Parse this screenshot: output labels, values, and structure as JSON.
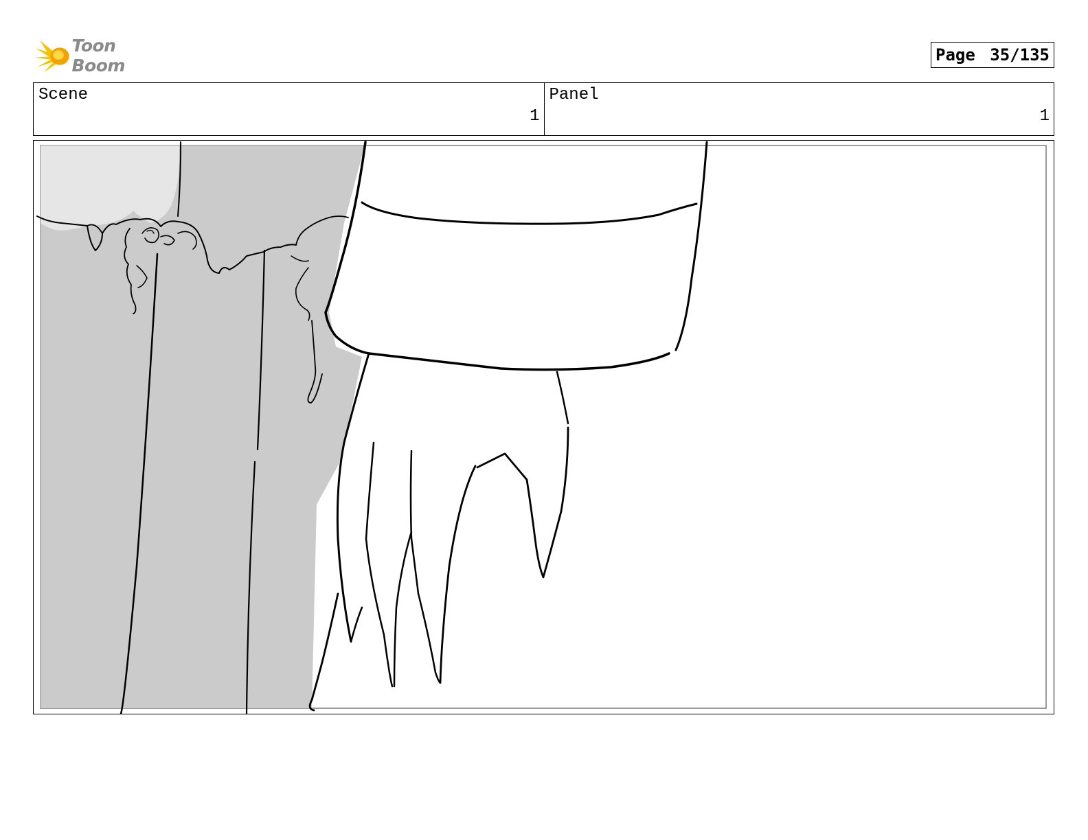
{
  "header": {
    "logo_text": "Toon Boom",
    "page_label": "Page",
    "page_number": "35/135"
  },
  "info": {
    "scene_label": "Scene",
    "scene_value": "1",
    "panel_label": "Panel",
    "panel_value": "1"
  },
  "panel": {
    "icon": "storyboard-sketch-hand-and-sleeve",
    "colors": {
      "background_shade": "#cbcbcb",
      "sky_patch": "#e6e6e6",
      "ink": "#000000"
    }
  }
}
